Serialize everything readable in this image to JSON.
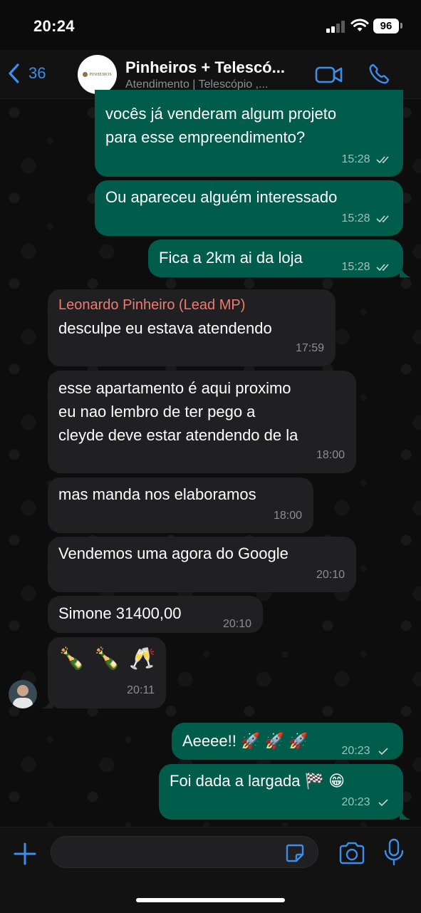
{
  "status": {
    "time": "20:24",
    "battery": "96"
  },
  "header": {
    "back_count": "36",
    "title": "Pinheiros + Telescó...",
    "subtitle": "Atendimento | Telescópio ,...",
    "logo_text": "PINHEIROS"
  },
  "messages": [
    {
      "text": "vocês já venderam algum projeto",
      "text2": "para esse empreendimento?",
      "time": "15:28"
    },
    {
      "text": "Ou apareceu alguém interessado",
      "time": "15:28"
    },
    {
      "text": "Fica a 2km ai da loja",
      "time": "15:28"
    },
    {
      "sender": "Leonardo Pinheiro (Lead MP)",
      "text": "desculpe eu estava atendendo",
      "time": "17:59"
    },
    {
      "text": "esse apartamento é aqui proximo",
      "text2": "eu nao lembro de ter pego a",
      "text3": "cleyde deve estar atendendo de la",
      "time": "18:00"
    },
    {
      "text": "mas manda nos elaboramos",
      "time": "18:00"
    },
    {
      "text": "Vendemos uma agora do Google",
      "time": "20:10"
    },
    {
      "text": "Simone 31400,00",
      "time": "20:10"
    },
    {
      "text": "🍾 🍾 🥂",
      "time": "20:11"
    },
    {
      "text": "Aeeee!! 🚀 🚀 🚀",
      "time": "20:23"
    },
    {
      "text": "Foi dada a largada 🏁 😁",
      "time": "20:23"
    }
  ],
  "composer": {
    "input_value": ""
  },
  "colors": {
    "outgoing": "#005c4b",
    "incoming": "#202022",
    "accent": "#3b8eea",
    "sender_name": "#ef7b6f"
  },
  "icons": [
    "back-chevron-icon",
    "video-call-icon",
    "phone-icon",
    "plus-icon",
    "sticker-icon",
    "camera-icon",
    "microphone-icon",
    "double-check-icon",
    "single-check-icon"
  ]
}
